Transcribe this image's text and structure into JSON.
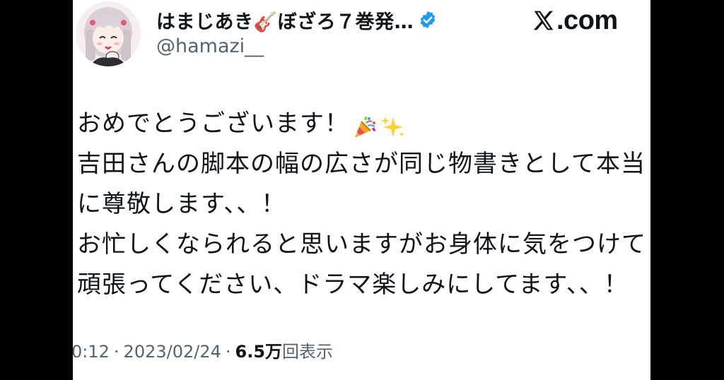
{
  "brand": {
    "site": ".com",
    "mark": "𝕏"
  },
  "author": {
    "display_name": "はまじあき🎸ぼざろ７巻発…",
    "handle": "@hamazi__",
    "verified": true
  },
  "tweet": {
    "lines": [
      "おめでとうございます！",
      "吉田さんの脚本の幅の広さが同じ物書きとして本当",
      "に尊敬します、、！",
      "お忙しくなられると思いますがお身体に気をつけて",
      "頑張ってください、ドラマ楽しみにしてます、、！"
    ],
    "line1_emojis": [
      "party-popper-icon",
      "sparkles-icon"
    ]
  },
  "meta": {
    "time": "0:12",
    "date": "2023/02/24",
    "views_count": "6.5万",
    "views_label": "回表示",
    "separator": "·"
  },
  "colors": {
    "text": "#0f1419",
    "secondary": "#536471",
    "verified": "#1d9bf0",
    "background_frame": "#000000",
    "card": "#ffffff"
  }
}
